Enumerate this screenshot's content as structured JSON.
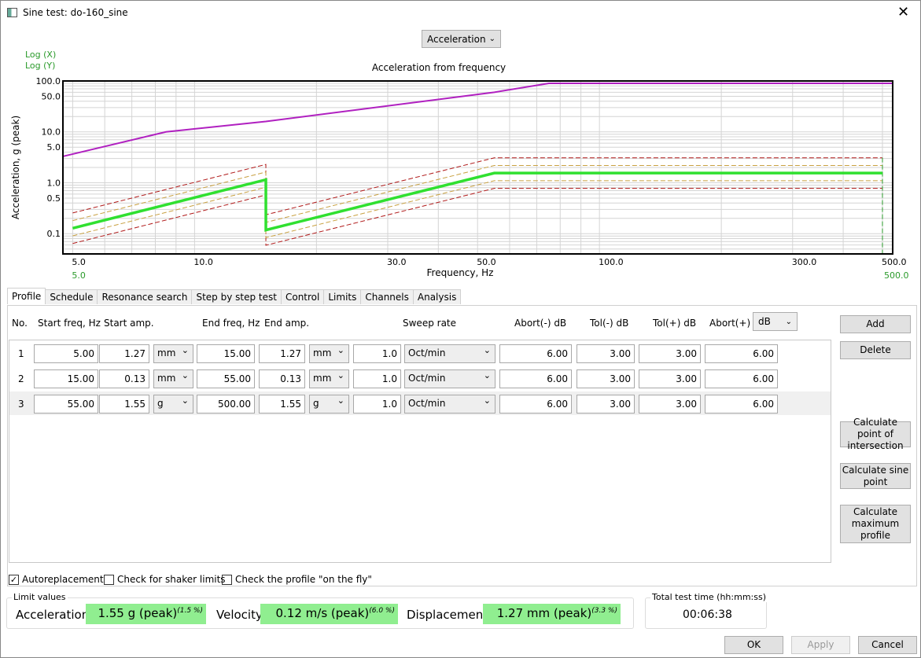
{
  "window": {
    "title": "Sine test: do-160_sine",
    "close_icon": "close-icon"
  },
  "view_select": {
    "value": "Acceleration"
  },
  "scale": {
    "x": "Log (X)",
    "y": "Log (Y)"
  },
  "chart_data": {
    "type": "line",
    "title": "Acceleration from frequency",
    "xlabel": "Frequency, Hz",
    "ylabel": "Acceleration, g (peak)",
    "x_scale": "log",
    "y_scale": "log",
    "xlim": [
      4.73,
      530
    ],
    "ylim": [
      0.04,
      100
    ],
    "grid": true,
    "x_ticks": [
      "5.0",
      "10.0",
      "30.0",
      "50.0",
      "100.0",
      "300.0",
      "500.0"
    ],
    "x_tick_values": [
      5,
      10,
      30,
      50,
      100,
      300,
      500
    ],
    "x_range_labels": [
      "5.0",
      "500.0"
    ],
    "y_ticks": [
      "100.0",
      "50.0",
      "10.0",
      "5.0",
      "1.0",
      "0.5",
      "0.1"
    ],
    "y_tick_values": [
      100,
      50,
      10,
      5,
      1,
      0.5,
      0.1
    ],
    "series": [
      {
        "role": "maximum",
        "color": "#b020c0",
        "x": [
          4.73,
          8.5,
          15,
          55,
          75,
          530
        ],
        "y": [
          3.3,
          10,
          16,
          60,
          90,
          90
        ]
      },
      {
        "role": "profile",
        "color": "#30e030",
        "x": [
          5,
          15,
          15,
          55,
          500
        ],
        "y": [
          0.128,
          1.15,
          0.118,
          1.55,
          1.55
        ]
      }
    ],
    "tolerance_db": 3,
    "abort_db": 6,
    "tolerance_color": "#c8a040",
    "abort_color": "#b01818"
  },
  "tabs": [
    "Profile",
    "Schedule",
    "Resonance search",
    "Step by step test",
    "Control",
    "Limits",
    "Channels",
    "Analysis"
  ],
  "columns": {
    "no": "No.",
    "start_freq": "Start freq, Hz",
    "start_amp": "Start amp.",
    "end_freq": "End freq, Hz",
    "end_amp": "End amp.",
    "sweep": "Sweep rate",
    "abort_minus": "Abort(-) dB",
    "tol_minus": "Tol(-) dB",
    "tol_plus": "Tol(+) dB",
    "abort_plus": "Abort(+)",
    "unit": "dB"
  },
  "rows": [
    {
      "no": "1",
      "start_freq": "5.00",
      "start_amp": "1.27",
      "start_unit": "mm",
      "end_freq": "15.00",
      "end_amp": "1.27",
      "end_unit": "mm",
      "rate": "1.0",
      "rate_unit": "Oct/min",
      "abort_minus": "6.00",
      "tol_minus": "3.00",
      "tol_plus": "3.00",
      "abort_plus": "6.00"
    },
    {
      "no": "2",
      "start_freq": "15.00",
      "start_amp": "0.13",
      "start_unit": "mm",
      "end_freq": "55.00",
      "end_amp": "0.13",
      "end_unit": "mm",
      "rate": "1.0",
      "rate_unit": "Oct/min",
      "abort_minus": "6.00",
      "tol_minus": "3.00",
      "tol_plus": "3.00",
      "abort_plus": "6.00"
    },
    {
      "no": "3",
      "start_freq": "55.00",
      "start_amp": "1.55",
      "start_unit": "g",
      "end_freq": "500.00",
      "end_amp": "1.55",
      "end_unit": "g",
      "rate": "1.0",
      "rate_unit": "Oct/min",
      "abort_minus": "6.00",
      "tol_minus": "3.00",
      "tol_plus": "3.00",
      "abort_plus": "6.00"
    }
  ],
  "side_buttons": {
    "add": "Add",
    "delete": "Delete",
    "intersection": "Calculate point of intersection",
    "sine_point": "Calculate sine point",
    "max_profile": "Calculate maximum profile"
  },
  "options": {
    "autoreplacement": "Autoreplacement",
    "autoreplacement_checked": true,
    "shaker": "Check for shaker limits",
    "shaker_checked": false,
    "fly": "Check the profile \"on the fly\"",
    "fly_checked": false
  },
  "limits": {
    "legend": "Limit values",
    "acc_label": "Acceleration",
    "acc": "1.55 g (peak)",
    "acc_pct": "(1.5 %)",
    "vel_label": "Velocity",
    "vel": "0.12 m/s (peak)",
    "vel_pct": "(6.0 %)",
    "disp_label": "Displacement",
    "disp": "1.27 mm (peak)",
    "disp_pct": "(3.3 %)",
    "bg": "#90ee90"
  },
  "total_time": {
    "legend": "Total test time  (hh:mm:ss)",
    "value": "00:06:38"
  },
  "footer": {
    "ok": "OK",
    "apply": "Apply",
    "cancel": "Cancel"
  }
}
